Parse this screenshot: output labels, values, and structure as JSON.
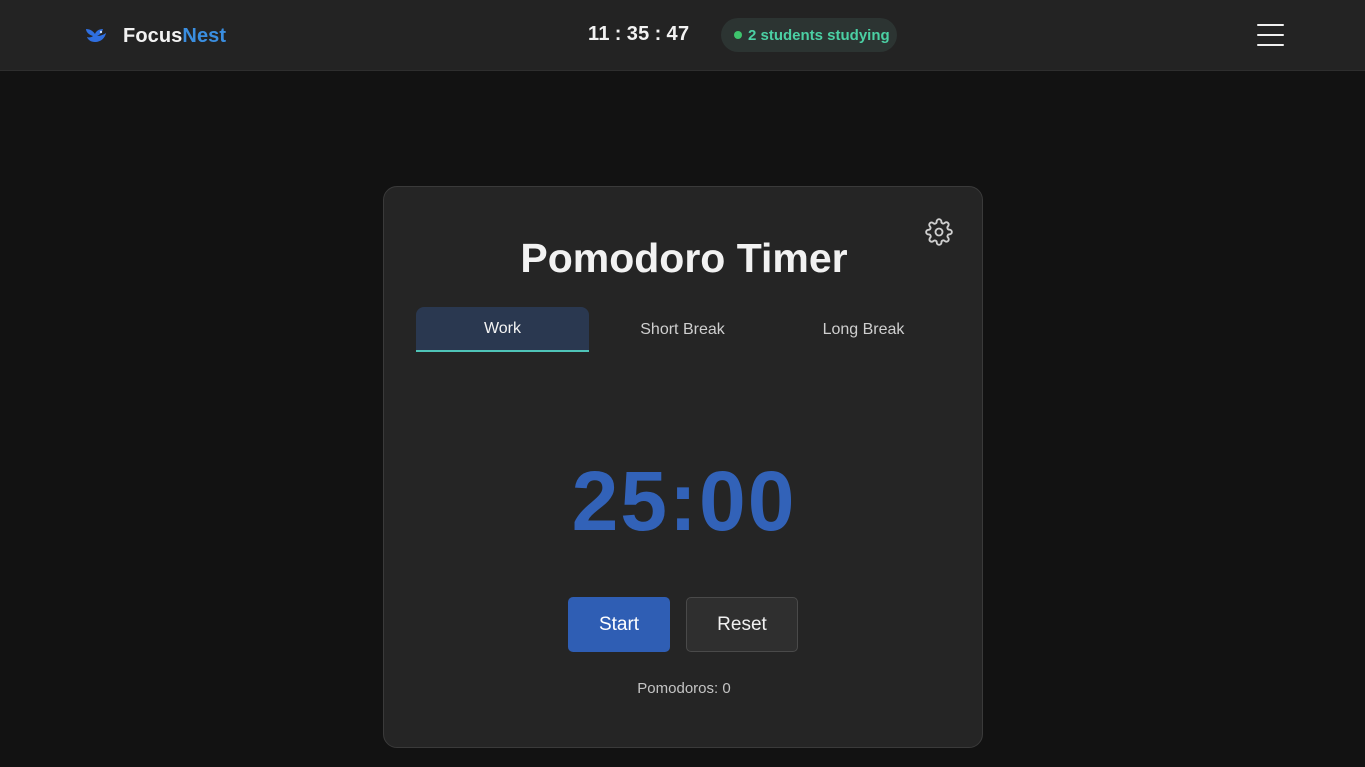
{
  "header": {
    "brand_primary": "Focus",
    "brand_accent": "Nest",
    "logo_icon": "blue-bird-icon",
    "clock": {
      "hours": "11",
      "separator": ":",
      "minutes": "35",
      "seconds": "47"
    },
    "studying_status": "2 students studying",
    "menu_icon": "hamburger-menu-icon"
  },
  "timer_card": {
    "title": "Pomodoro Timer",
    "settings_icon": "gear-icon",
    "tabs": [
      {
        "label": "Work",
        "active": true
      },
      {
        "label": "Short Break",
        "active": false
      },
      {
        "label": "Long Break",
        "active": false
      }
    ],
    "time_display": "25:00",
    "start_label": "Start",
    "reset_label": "Reset",
    "pomodoro_count_text": "Pomodoros: 0"
  },
  "colors": {
    "accent_blue": "#2f5eb4",
    "timer_blue": "#3262b8",
    "brand_accent": "#3a8ee0",
    "status_green": "#3ec46d",
    "tab_underline": "#4fc4b8"
  }
}
